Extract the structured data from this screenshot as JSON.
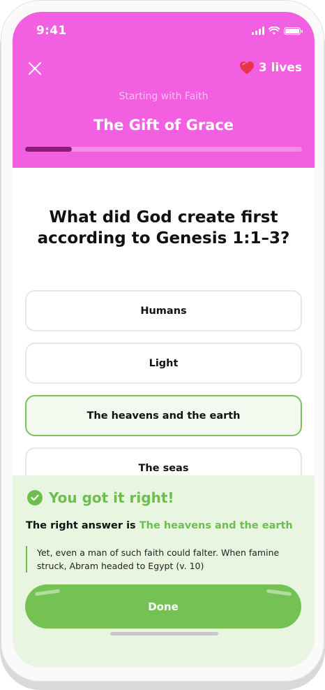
{
  "status_bar": {
    "time": "9:41"
  },
  "header": {
    "lives_label": "3 lives",
    "lesson_subtitle": "Starting with Faith",
    "lesson_title": "The Gift of Grace",
    "progress_fraction": 0.17
  },
  "question": {
    "text": "What did God create first according to Genesis 1:1–3?"
  },
  "options": [
    {
      "label": "Humans"
    },
    {
      "label": "Light"
    },
    {
      "label": "The heavens and the earth"
    },
    {
      "label": "The seas"
    }
  ],
  "result": {
    "headline": "You got it right!",
    "answer_prefix": "The right answer is",
    "answer_value": "The heavens and the earth",
    "explanation": "Yet, even a man of such faith could falter. When famine struck, Abram headed to Egypt (v. 10)",
    "done_label": "Done"
  },
  "colors": {
    "header_bg": "#f25fe0",
    "progress_fill": "#8a1a78",
    "success_green": "#6dbd4f",
    "panel_bg": "#e8f6e1",
    "done_button": "#74c254"
  },
  "icons": {
    "close": "close-icon",
    "heart": "heart-icon",
    "check": "check-circle-icon"
  }
}
